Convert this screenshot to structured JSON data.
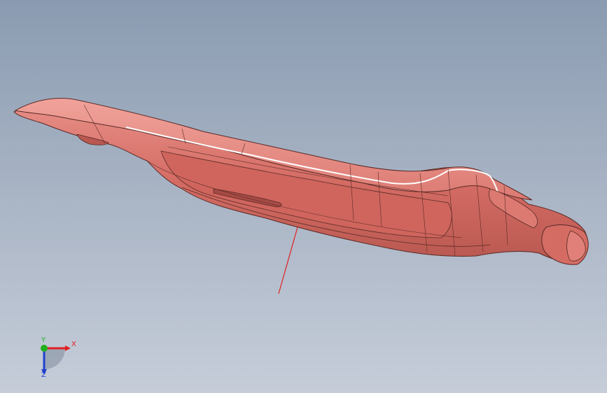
{
  "viewport": {
    "background_top": "#8a9bb1",
    "background_bottom": "#c6cdd9"
  },
  "part": {
    "name": "pink-cad-part",
    "fill_color": "#d9736b",
    "edge_color": "#5a2a26",
    "highlight_color": "#ffffff"
  },
  "sketch_line": {
    "color": "#e02020"
  },
  "triad": {
    "x_label": "X",
    "y_label": "Y",
    "z_label": "Z",
    "x_color": "#e02020",
    "y_color": "#20b020",
    "z_color": "#2040d0"
  }
}
